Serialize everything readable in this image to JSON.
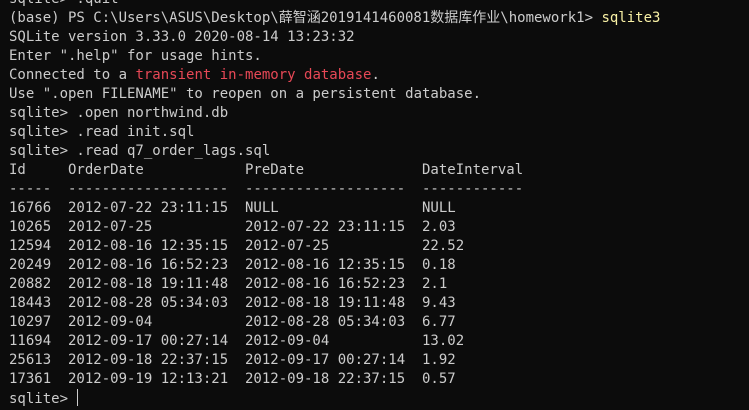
{
  "terminal": {
    "lines": [
      {
        "text": "sqlite> .quit"
      },
      {
        "segments": [
          {
            "text": "(base) PS C:\\Users\\ASUS\\Desktop\\薛智涵2019141460081数据库作业\\homework1> ",
            "color": "default"
          },
          {
            "text": "sqlite3",
            "color": "yellow"
          }
        ]
      },
      {
        "text": "SQLite version 3.33.0 2020-08-14 13:23:32"
      },
      {
        "text": "Enter \".help\" for usage hints."
      },
      {
        "segments": [
          {
            "text": "Connected to a ",
            "color": "default"
          },
          {
            "text": "transient in-memory database",
            "color": "red"
          },
          {
            "text": ".",
            "color": "default"
          }
        ]
      },
      {
        "text": "Use \".open FILENAME\" to reopen on a persistent database."
      },
      {
        "text": "sqlite> .open northwind.db"
      },
      {
        "text": "sqlite> .read init.sql"
      },
      {
        "text": "sqlite> .read q7_order_lags.sql"
      },
      {
        "text": "Id     OrderDate            PreDate              DateInterval"
      },
      {
        "text": "-----  -------------------  -------------------  ------------"
      },
      {
        "text": "16766  2012-07-22 23:11:15  NULL                 NULL"
      },
      {
        "text": "10265  2012-07-25           2012-07-22 23:11:15  2.03"
      },
      {
        "text": "12594  2012-08-16 12:35:15  2012-07-25           22.52"
      },
      {
        "text": "20249  2012-08-16 16:52:23  2012-08-16 12:35:15  0.18"
      },
      {
        "text": "20882  2012-08-18 19:11:48  2012-08-16 16:52:23  2.1"
      },
      {
        "text": "18443  2012-08-28 05:34:03  2012-08-18 19:11:48  9.43"
      },
      {
        "text": "10297  2012-09-04           2012-08-28 05:34:03  6.77"
      },
      {
        "text": "11694  2012-09-17 00:27:14  2012-09-04           13.02"
      },
      {
        "text": "25613  2012-09-18 22:37:15  2012-09-17 00:27:14  1.92"
      },
      {
        "text": "17361  2012-09-19 12:13:21  2012-09-18 22:37:15  0.57"
      }
    ],
    "prompt": "sqlite> ",
    "colors": {
      "background": "#0c0c0c",
      "default": "#cccccc",
      "red": "#e74856",
      "yellow": "#f9f1a5"
    }
  }
}
